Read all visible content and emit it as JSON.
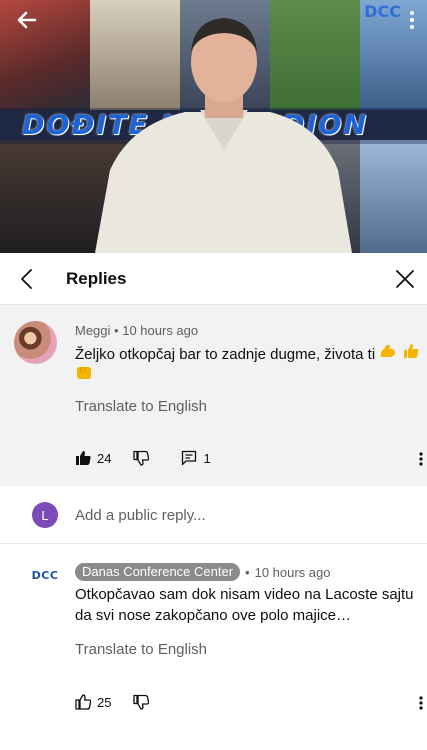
{
  "video": {
    "banner_text": "DOĐITE NA STADION",
    "logo_text": "DCC"
  },
  "replies_panel": {
    "title": "Replies"
  },
  "main_comment": {
    "author": "Meggi",
    "separator": "•",
    "time": "10 hours ago",
    "text": "Željko otkopčaj bar to zadnje dugme, životа ti",
    "emojis": [
      "flexed-biceps",
      "thumbs-up",
      "oncoming-fist"
    ],
    "translate_label": "Translate to English",
    "like_count": "24",
    "reply_count": "1"
  },
  "add_reply": {
    "avatar_letter": "L",
    "placeholder": "Add a public reply..."
  },
  "reply_comment": {
    "avatar_text": "DCC",
    "author": "Danas Conference Center",
    "separator": "•",
    "time": "10 hours ago",
    "text": "Otkopčavao sam dok nisam video na Lacoste sajtu da svi nose zakopčano ove polo majice…",
    "translate_label": "Translate to English",
    "like_count": "25"
  },
  "colors": {
    "avatar_purple": "#7d4bb8",
    "highlight_bg": "#f2f2f2",
    "chip_gray": "#8b8b8b",
    "banner_blue": "#1e63d6"
  }
}
